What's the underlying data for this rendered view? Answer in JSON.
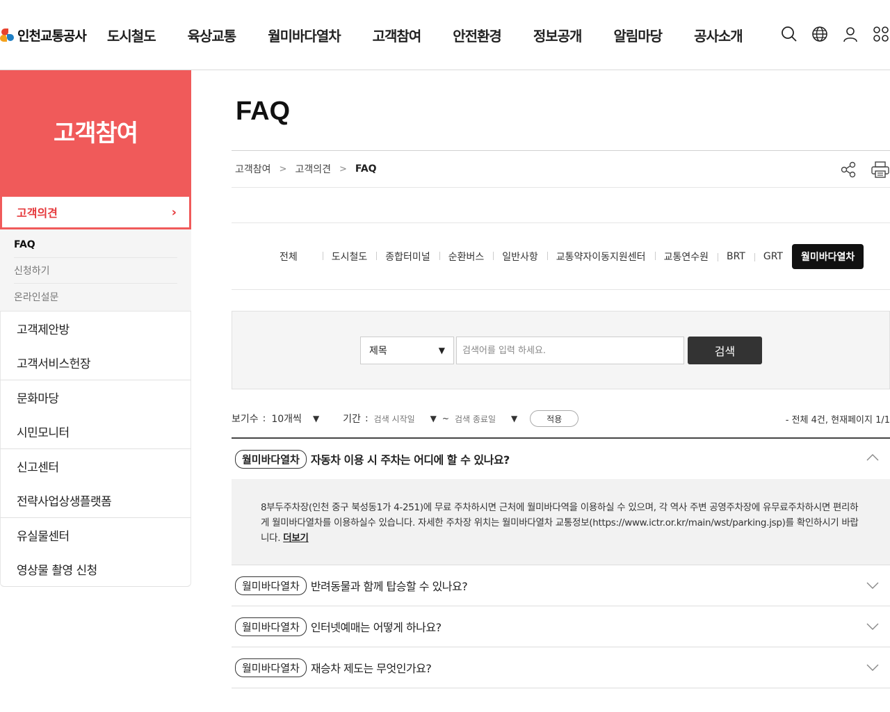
{
  "header": {
    "logo_text": "인천교통공사",
    "nav": [
      "도시철도",
      "육상교통",
      "월미바다열차",
      "고객참여",
      "안전환경",
      "정보공개",
      "알림마당",
      "공사소개"
    ]
  },
  "sidebar": {
    "title": "고객참여",
    "active": "고객의견",
    "sub_items": [
      "FAQ",
      "신청하기",
      "온라인설문"
    ],
    "groups": [
      [
        "고객제안방",
        "고객서비스헌장"
      ],
      [
        "문화마당",
        "시민모니터"
      ],
      [
        "신고센터",
        "전략사업상생플랫폼"
      ],
      [
        "유실물센터",
        "영상물 촬영 신청"
      ]
    ]
  },
  "main": {
    "title": "FAQ",
    "breadcrumb": [
      "고객참여",
      "고객의견",
      "FAQ"
    ],
    "tabs": [
      "전체",
      "도시철도",
      "종합터미널",
      "순환버스",
      "일반사항",
      "교통약자이동지원센터",
      "교통연수원",
      "BRT",
      "GRT",
      "월미바다열차"
    ],
    "active_tab": "월미바다열차",
    "search": {
      "select_value": "제목",
      "placeholder": "검색어를 입력 하세요.",
      "button": "검색"
    },
    "filter": {
      "count_label": "보기수",
      "count_value": "10개씩",
      "period_label": "기간",
      "start_placeholder": "검색 시작일",
      "tilde": "~",
      "end_placeholder": "검색 종료일",
      "apply": "적용",
      "total": "- 전체 4건, 현재페이지 1/1"
    },
    "faqs": [
      {
        "badge": "월미바다열차",
        "question": "자동차 이용 시 주차는 어디에 할 수 있나요?",
        "expanded": true,
        "answer": "8부두주차장(인천 중구 북성동1가 4-251)에 무료 주차하시면 근처에 월미바다역을 이용하실 수 있으며, 각 역사 주변 공영주차장에 유무료주차하시면 편리하게 월미바다열차를 이용하실수 있습니다. 자세한 주차장 위치는 월미바다열차 교통정보(https://www.ictr.or.kr/main/wst/parking.jsp)를 확인하시기 바랍니다.",
        "more": "더보기"
      },
      {
        "badge": "월미바다열차",
        "question": "반려동물과 함께 탑승할 수 있나요?",
        "expanded": false
      },
      {
        "badge": "월미바다열차",
        "question": "인터넷예매는 어떻게 하나요?",
        "expanded": false
      },
      {
        "badge": "월미바다열차",
        "question": "재승차 제도는 무엇인가요?",
        "expanded": false
      }
    ]
  }
}
